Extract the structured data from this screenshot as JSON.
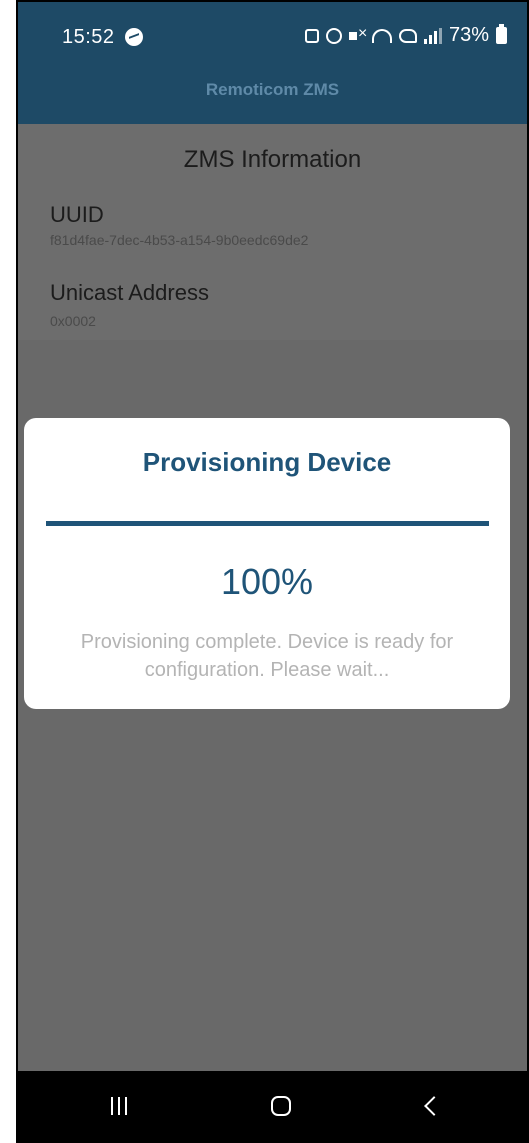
{
  "status_bar": {
    "time": "15:52",
    "battery_percent": "73%",
    "icons": [
      "messenger-icon",
      "lock-icon",
      "alarm-icon",
      "mute-icon",
      "wifi-icon",
      "volte-icon",
      "signal-icon",
      "battery-icon"
    ]
  },
  "app": {
    "title": "Remoticom ZMS"
  },
  "info": {
    "section_title": "ZMS Information",
    "uuid_label": "UUID",
    "uuid_value": "f81d4fae-7dec-4b53-a154-9b0eedc69de2",
    "unicast_label": "Unicast Address",
    "unicast_value": "0x0002"
  },
  "dialog": {
    "title": "Provisioning Device",
    "progress_value": 1.0,
    "progress_text": "100%",
    "message": "Provisioning complete. Device is ready for configuration. Please wait..."
  },
  "nav_bar": {
    "icons": [
      "recent-apps-icon",
      "home-icon",
      "back-icon"
    ]
  },
  "colors": {
    "header": "#1e4a66",
    "accent": "#1f5478",
    "overlay": "#696969"
  }
}
